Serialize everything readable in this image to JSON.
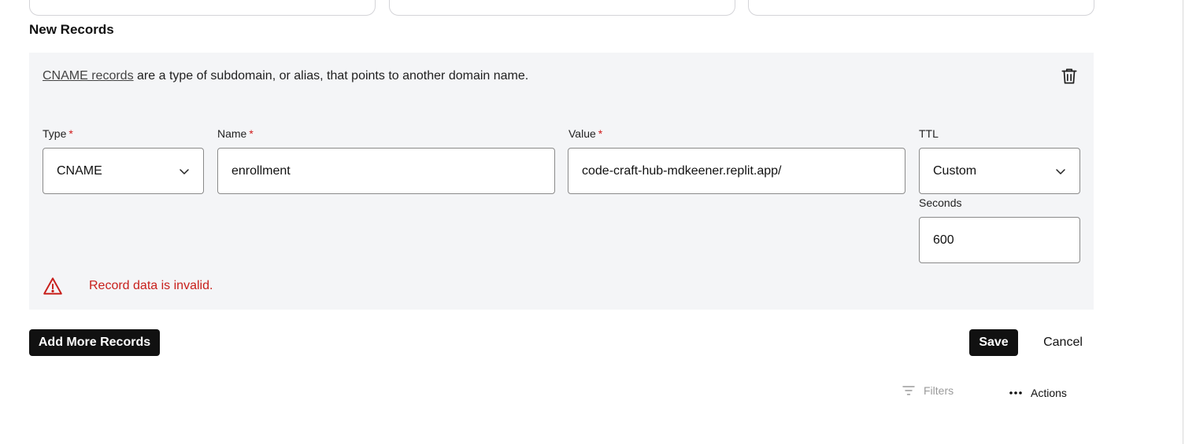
{
  "section": {
    "title": "New Records"
  },
  "record": {
    "description_link": "CNAME records",
    "description_rest": " are a type of subdomain, or alias, that points to another domain name.",
    "type": {
      "label": "Type",
      "required_mark": "*",
      "value": "CNAME"
    },
    "name": {
      "label": "Name",
      "required_mark": "*",
      "value": "enrollment"
    },
    "value": {
      "label": "Value",
      "required_mark": "*",
      "value": "code-craft-hub-mdkeener.replit.app/"
    },
    "ttl": {
      "label": "TTL",
      "value": "Custom"
    },
    "seconds": {
      "label": "Seconds",
      "value": "600"
    },
    "error": "Record data is invalid."
  },
  "actions": {
    "add_more": "Add More Records",
    "save": "Save",
    "cancel": "Cancel"
  },
  "toolbar": {
    "filters": "Filters",
    "actions": "Actions"
  },
  "icons": {
    "delete": "trash-icon",
    "chevron": "chevron-down-icon",
    "warning": "warning-triangle-icon",
    "filter": "filter-icon",
    "more": "more-horizontal-icon"
  },
  "colors": {
    "error": "#c8201c",
    "required": "#d01919",
    "panel_bg": "#f4f5f7",
    "button_dark": "#111111"
  }
}
